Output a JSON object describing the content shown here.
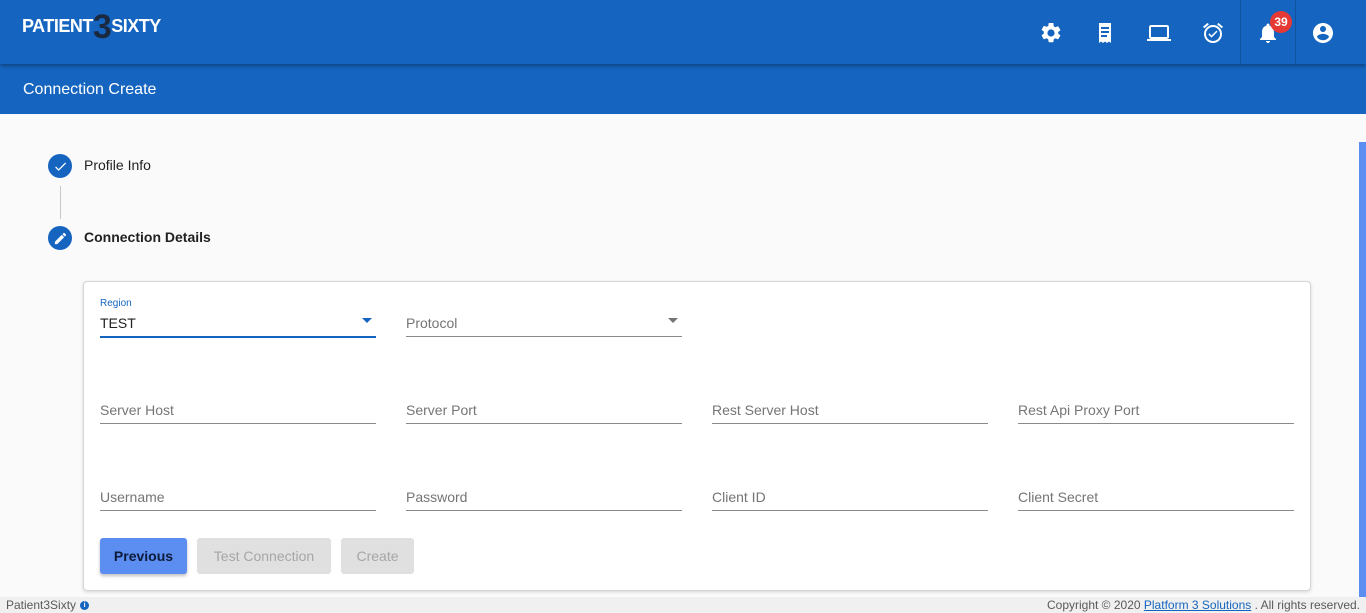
{
  "app": {
    "logo_left": "PATIENT",
    "logo_mid": "3",
    "logo_right": "SIXTY"
  },
  "header": {
    "notification_count": "39",
    "icons": [
      "settings-icon",
      "receipt-icon",
      "laptop-icon",
      "alarm-check-icon",
      "bell-icon",
      "account-circle-icon"
    ]
  },
  "page": {
    "title": "Connection Create"
  },
  "stepper": {
    "steps": [
      {
        "label": "Profile Info",
        "state": "done"
      },
      {
        "label": "Connection Details",
        "state": "editing"
      }
    ]
  },
  "form": {
    "region": {
      "label": "Region",
      "value": "TEST"
    },
    "protocol": {
      "placeholder": "Protocol"
    },
    "server_host": {
      "placeholder": "Server Host"
    },
    "server_port": {
      "placeholder": "Server Port"
    },
    "rest_server_host": {
      "placeholder": "Rest Server Host"
    },
    "rest_api_proxy_port": {
      "placeholder": "Rest Api Proxy Port"
    },
    "username": {
      "placeholder": "Username"
    },
    "password": {
      "placeholder": "Password"
    },
    "client_id": {
      "placeholder": "Client ID"
    },
    "client_secret": {
      "placeholder": "Client Secret"
    }
  },
  "buttons": {
    "previous": "Previous",
    "test_connection": "Test Connection",
    "create": "Create"
  },
  "footer": {
    "app_name": "Patient3Sixty",
    "info_icon": "i",
    "copyright_prefix": "Copyright © 2020",
    "company_link": "Platform 3 Solutions",
    "copyright_suffix": ". All rights reserved."
  },
  "colors": {
    "primary": "#1565c0",
    "button_primary": "#5b8ef0",
    "badge": "#e53935"
  }
}
